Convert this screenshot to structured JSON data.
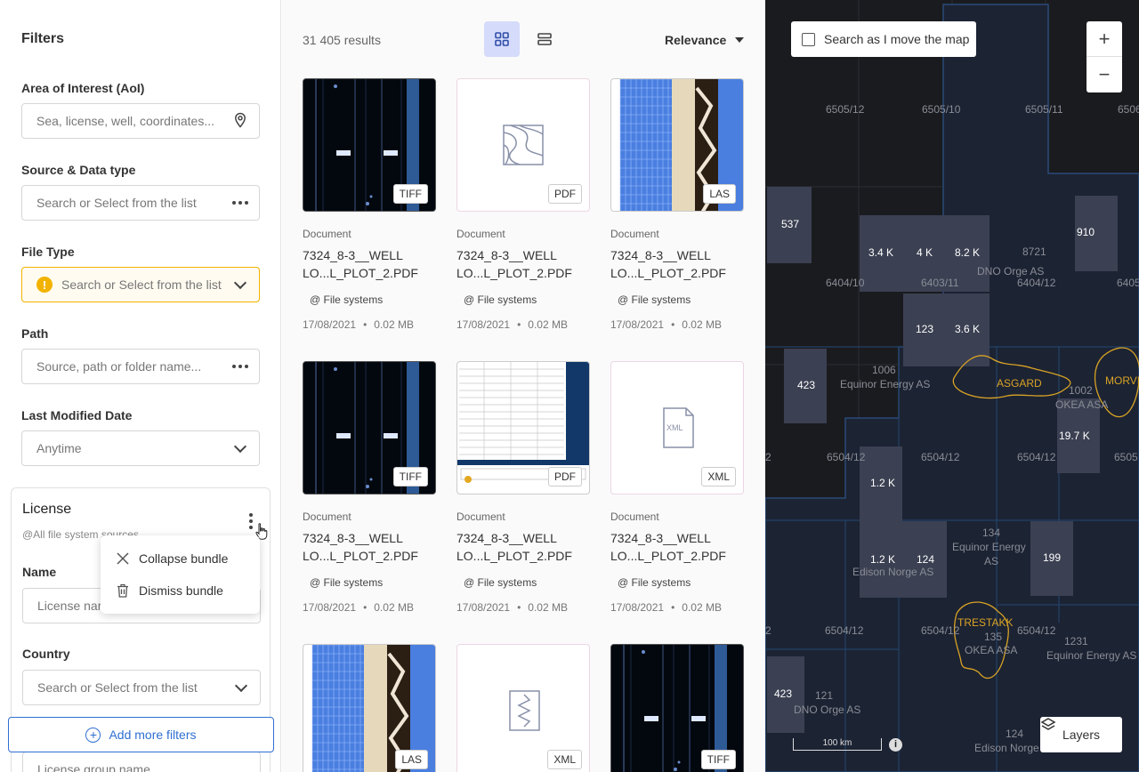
{
  "filters": {
    "title": "Filters",
    "aoi": {
      "label": "Area of Interest (AoI)",
      "placeholder": "Sea, license, well, coordinates..."
    },
    "source": {
      "label": "Source & Data type",
      "placeholder": "Search or Select from the list"
    },
    "filetype": {
      "label": "File Type",
      "placeholder": "Search or Select from the list"
    },
    "path": {
      "label": "Path",
      "placeholder": "Source, path or folder name..."
    },
    "modified": {
      "label": "Last Modified Date",
      "value": "Anytime"
    },
    "license": {
      "title": "License",
      "subtitle": "@All file system sources",
      "name_label": "Name",
      "name_placeholder": "License name",
      "country_label": "Country",
      "country_placeholder": "Search or Select from the list",
      "group_placeholder": "License group name"
    },
    "menu": {
      "collapse": "Collapse bundle",
      "dismiss": "Dismiss bundle"
    },
    "add_more": "Add more filters"
  },
  "results": {
    "count": "31 405 results",
    "sort": "Relevance",
    "cards": [
      {
        "kind": "tiff",
        "badge": "TIFF",
        "type": "Document",
        "title": "7324_8-3__WELL LO...L_PLOT_2.PDF",
        "source": "@ File systems",
        "date": "17/08/2021",
        "size": "0.02 MB"
      },
      {
        "kind": "pdf-icon",
        "badge": "PDF",
        "type": "Document",
        "title": "7324_8-3__WELL LO...L_PLOT_2.PDF",
        "source": "@ File systems",
        "date": "17/08/2021",
        "size": "0.02 MB"
      },
      {
        "kind": "las",
        "badge": "LAS",
        "type": "Document",
        "title": "7324_8-3__WELL LO...L_PLOT_2.PDF",
        "source": "@ File systems",
        "date": "17/08/2021",
        "size": "0.02 MB"
      },
      {
        "kind": "tiff",
        "badge": "TIFF",
        "type": "Document",
        "title": "7324_8-3__WELL LO...L_PLOT_2.PDF",
        "source": "@ File systems",
        "date": "17/08/2021",
        "size": "0.02 MB"
      },
      {
        "kind": "pdf-doc",
        "badge": "PDF",
        "type": "Document",
        "title": "7324_8-3__WELL LO...L_PLOT_2.PDF",
        "source": "@ File systems",
        "date": "17/08/2021",
        "size": "0.02 MB"
      },
      {
        "kind": "xml-icon",
        "badge": "XML",
        "type": "Document",
        "title": "7324_8-3__WELL LO...L_PLOT_2.PDF",
        "source": "@ File systems",
        "date": "17/08/2021",
        "size": "0.02 MB"
      },
      {
        "kind": "las",
        "badge": "LAS"
      },
      {
        "kind": "xml-wave",
        "badge": "XML"
      },
      {
        "kind": "tiff",
        "badge": "TIFF"
      }
    ]
  },
  "map": {
    "search_as_move": "Search as I move the map",
    "zoom_in": "+",
    "zoom_out": "−",
    "layers": "Layers",
    "scale": "100 km",
    "block_labels": [
      "6505/12",
      "6505/10",
      "6505/11",
      "6506",
      "6404/10",
      "6403/11",
      "6404/12",
      "6405",
      "2",
      "6504/12",
      "6504/12",
      "6504/12",
      "6505",
      "2",
      "6504/12",
      "6504/12",
      "6504/12"
    ],
    "companies": [
      "8721",
      "DNO Orge AS",
      "1006",
      "Equinor Energy AS",
      "1002",
      "OKEA ASA",
      "134",
      "Equinor Energy",
      "AS",
      "Edison Norge AS",
      "135",
      "OKEA ASA",
      "1231",
      "Equinor Energy AS",
      "121",
      "DNO Orge AS",
      "124",
      "Edison Norge"
    ],
    "counts": [
      "537",
      "3.4 K",
      "4 K",
      "8.2 K",
      "910",
      "123",
      "3.6 K",
      "423",
      "19.7 K",
      "1.2 K",
      "1.2 K",
      "124",
      "199",
      "423"
    ],
    "fields": [
      "ASGARD",
      "MORVI",
      "TRESTAKK"
    ]
  }
}
